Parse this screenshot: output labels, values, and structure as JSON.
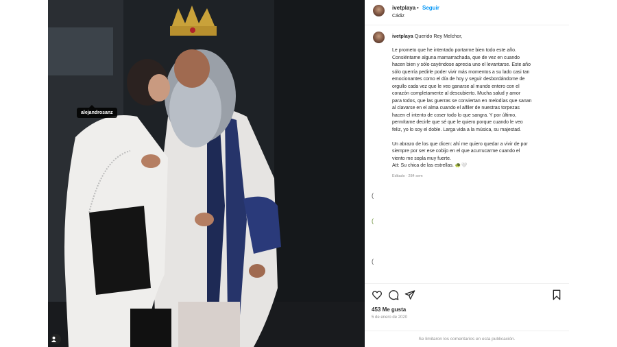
{
  "photo": {
    "tag_label": "alejandrosanz",
    "tags_icon": "user-tag-icon"
  },
  "header": {
    "username": "ivetplaya",
    "separator": "•",
    "follow_label": "Seguir",
    "location": "Cádiz",
    "avatar_icon": "avatar"
  },
  "caption": {
    "username": "ivetplaya",
    "greeting": "Querido Rey Melchor,",
    "body": "Le prometo que he intentado portarme bien todo este año.\nConsiéntame alguna mamarrachada, que de vez en cuando\nhacen bien y sólo cayéndose aprecia uno el levantarse. Este año\nsólo querría pedirle poder vivir más momentos a su lado casi tan\nemocionantes como el día de hoy y seguir desbordándome de\norgullo cada vez que le veo ganarse al mundo entero con el\ncorazón completamente al descubierto. Mucha salud y amor\npara todos, que las guerras se conviertan en melodías que sanan\nal clavarse en el alma cuando el alfiler de nuestras torpezas\nhacen el intento de coser todo lo que sangra. Y por último,\npermítame decirle que sé que le quiero porque cuando le veo\nfeliz, yo lo soy el doble. Larga vida a la música, su majestad.\n\nUn abrazo de los que dicen: ahí me quiero quedar a vivir de por\nsiempre por ser ese cobijo en el que acurrucarme cuando el\nviento me sopla muy fuerte.\nAtt: Su chica de las estrellas. 🐢🤍",
    "edited": "Editado · 284 sem"
  },
  "actions": {
    "like_icon": "heart-icon",
    "comment_icon": "comment-icon",
    "share_icon": "share-icon",
    "save_icon": "bookmark-icon",
    "likes": "453 Me gusta",
    "date": "5 de enero de 2020",
    "comments_disabled": "Se limitaron los comentarios en esta publicación."
  },
  "colors": {
    "follow_blue": "#0095f6",
    "text": "#262626",
    "muted": "#8e8e8e"
  }
}
